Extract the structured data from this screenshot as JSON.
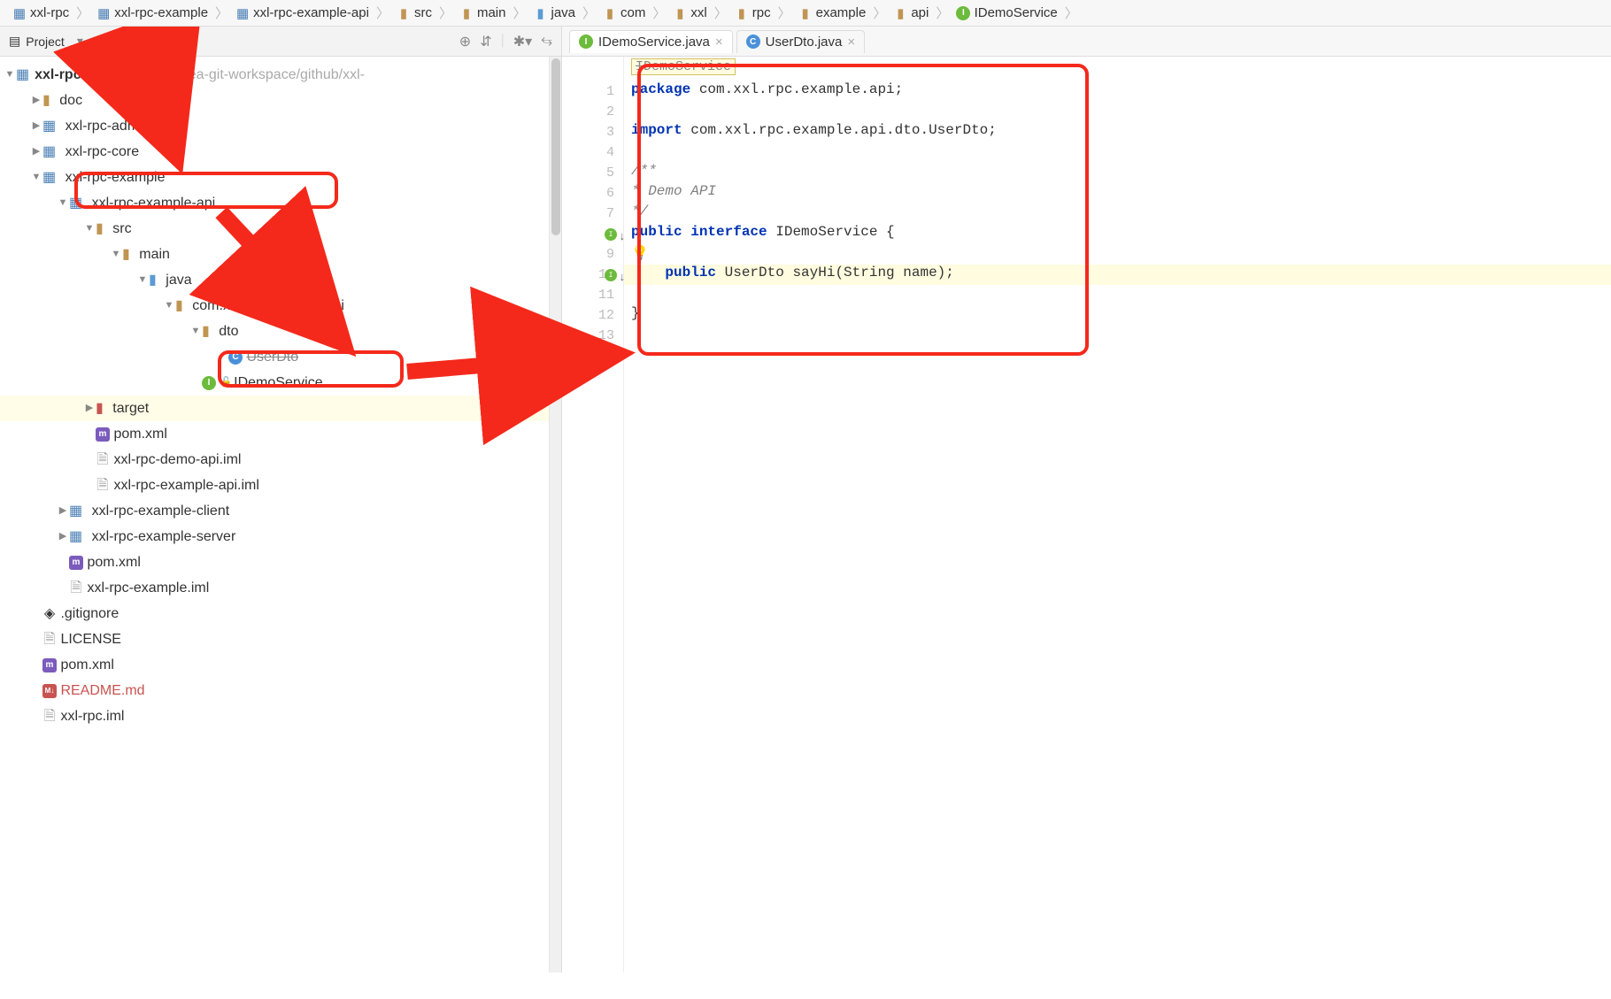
{
  "breadcrumb": [
    {
      "label": "xxl-rpc",
      "type": "module"
    },
    {
      "label": "xxl-rpc-example",
      "type": "module"
    },
    {
      "label": "xxl-rpc-example-api",
      "type": "module"
    },
    {
      "label": "src",
      "type": "folder"
    },
    {
      "label": "main",
      "type": "folder"
    },
    {
      "label": "java",
      "type": "src-folder"
    },
    {
      "label": "com",
      "type": "folder"
    },
    {
      "label": "xxl",
      "type": "folder"
    },
    {
      "label": "rpc",
      "type": "folder"
    },
    {
      "label": "example",
      "type": "folder"
    },
    {
      "label": "api",
      "type": "folder"
    },
    {
      "label": "IDemoService",
      "type": "interface"
    }
  ],
  "panel": {
    "title": "Project"
  },
  "tree": {
    "root": {
      "label": "xxl-rpc",
      "path": "~/workspaces/idea-git-workspace/github/xxl-"
    },
    "items": [
      {
        "depth": 1,
        "expand": "closed",
        "icon": "folder",
        "label": "doc"
      },
      {
        "depth": 1,
        "expand": "closed",
        "icon": "module",
        "label": "xxl-rpc-admin"
      },
      {
        "depth": 1,
        "expand": "closed",
        "icon": "module",
        "label": "xxl-rpc-core"
      },
      {
        "depth": 1,
        "expand": "open",
        "icon": "module",
        "label": "xxl-rpc-example"
      },
      {
        "depth": 2,
        "expand": "open",
        "icon": "module",
        "label": "xxl-rpc-example-api",
        "boxed": true
      },
      {
        "depth": 3,
        "expand": "open",
        "icon": "folder",
        "label": "src"
      },
      {
        "depth": 4,
        "expand": "open",
        "icon": "folder",
        "label": "main"
      },
      {
        "depth": 5,
        "expand": "open",
        "icon": "src-folder",
        "label": "java"
      },
      {
        "depth": 6,
        "expand": "open",
        "icon": "folder",
        "label": "com.xxl.rpc.example.api",
        "obscured": true
      },
      {
        "depth": 7,
        "expand": "open",
        "icon": "folder",
        "label": "dto"
      },
      {
        "depth": 8,
        "expand": "none",
        "icon": "class",
        "label": "UserDto",
        "struck": true
      },
      {
        "depth": 7,
        "expand": "none",
        "icon": "interface",
        "label": "IDemoService",
        "boxed": true,
        "vcs": true
      },
      {
        "depth": 3,
        "expand": "closed",
        "icon": "target",
        "label": "target",
        "highlight": true
      },
      {
        "depth": 3,
        "expand": "none",
        "icon": "m",
        "label": "pom.xml"
      },
      {
        "depth": 3,
        "expand": "none",
        "icon": "file",
        "label": "xxl-rpc-demo-api.iml"
      },
      {
        "depth": 3,
        "expand": "none",
        "icon": "file",
        "label": "xxl-rpc-example-api.iml"
      },
      {
        "depth": 2,
        "expand": "closed",
        "icon": "module",
        "label": "xxl-rpc-example-client"
      },
      {
        "depth": 2,
        "expand": "closed",
        "icon": "module",
        "label": "xxl-rpc-example-server"
      },
      {
        "depth": 2,
        "expand": "none",
        "icon": "m",
        "label": "pom.xml"
      },
      {
        "depth": 2,
        "expand": "none",
        "icon": "file",
        "label": "xxl-rpc-example.iml"
      },
      {
        "depth": 1,
        "expand": "none",
        "icon": "git",
        "label": ".gitignore"
      },
      {
        "depth": 1,
        "expand": "none",
        "icon": "file",
        "label": "LICENSE"
      },
      {
        "depth": 1,
        "expand": "none",
        "icon": "m",
        "label": "pom.xml"
      },
      {
        "depth": 1,
        "expand": "none",
        "icon": "md",
        "label": "README.md",
        "red": true
      },
      {
        "depth": 1,
        "expand": "none",
        "icon": "file",
        "label": "xxl-rpc.iml"
      }
    ]
  },
  "tabs": [
    {
      "label": "IDemoService.java",
      "icon": "interface",
      "active": true
    },
    {
      "label": "UserDto.java",
      "icon": "class",
      "active": false
    }
  ],
  "editor": {
    "classnameTip": "IDemoService",
    "lines": [
      {
        "n": 1,
        "tokens": [
          {
            "t": "kw",
            "v": "package "
          },
          {
            "t": "",
            "v": "com.xxl.rpc.example.api;"
          }
        ]
      },
      {
        "n": 2,
        "tokens": []
      },
      {
        "n": 3,
        "tokens": [
          {
            "t": "kw",
            "v": "import "
          },
          {
            "t": "",
            "v": "com.xxl.rpc.example.api.dto.UserDto;"
          }
        ]
      },
      {
        "n": 4,
        "tokens": []
      },
      {
        "n": 5,
        "tokens": [
          {
            "t": "comment",
            "v": "/**"
          }
        ]
      },
      {
        "n": 6,
        "tokens": [
          {
            "t": "comment",
            "v": " * Demo API"
          }
        ]
      },
      {
        "n": 7,
        "tokens": [
          {
            "t": "comment",
            "v": " */"
          }
        ]
      },
      {
        "n": 8,
        "marker": "I",
        "tokens": [
          {
            "t": "kw",
            "v": "public interface "
          },
          {
            "t": "",
            "v": "IDemoService {"
          }
        ]
      },
      {
        "n": 9,
        "bulb": true,
        "tokens": []
      },
      {
        "n": 10,
        "marker": "I",
        "hl": true,
        "indent": 1,
        "tokens": [
          {
            "t": "kw",
            "v": "public "
          },
          {
            "t": "",
            "v": "UserDto sayHi(String name);"
          }
        ]
      },
      {
        "n": 11,
        "tokens": []
      },
      {
        "n": 12,
        "tokens": [
          {
            "t": "",
            "v": "}"
          }
        ]
      },
      {
        "n": 13,
        "tokens": []
      }
    ]
  }
}
